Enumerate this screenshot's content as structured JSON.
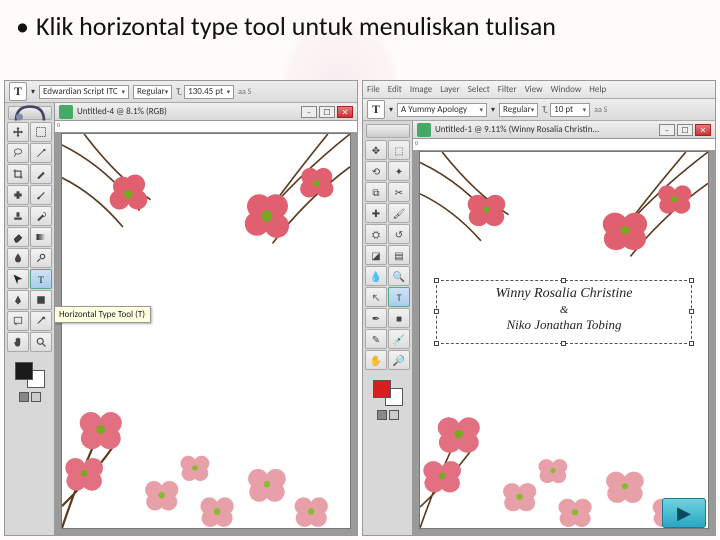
{
  "bullet": "Klik horizontal type tool untuk menuliskan tulisan",
  "menu": [
    "File",
    "Edit",
    "Image",
    "Layer",
    "Select",
    "Filter",
    "View",
    "Window",
    "Help"
  ],
  "left": {
    "font": "Edwardian Script ITC",
    "style": "Regular",
    "size": "130.45 pt",
    "doc_title": "Untitled-4 @ 8.1% (RGB)",
    "tooltip": "Horizontal Type Tool (T)",
    "fg_color": "#1a1a1a"
  },
  "right": {
    "font": "A Yummy Apology",
    "style": "Regular",
    "size": "10 pt",
    "doc_title": "Untitled-1 @ 9.11% (Winny Rosalia Christin...",
    "text_name1": "Winny Rosalia Christine",
    "text_amp": "&",
    "text_name2": "Niko Jonathan Tobing",
    "fg_color": "#d62020"
  },
  "ruler_label": "0",
  "nav_icon": "▶",
  "aa_label": "aa  S"
}
